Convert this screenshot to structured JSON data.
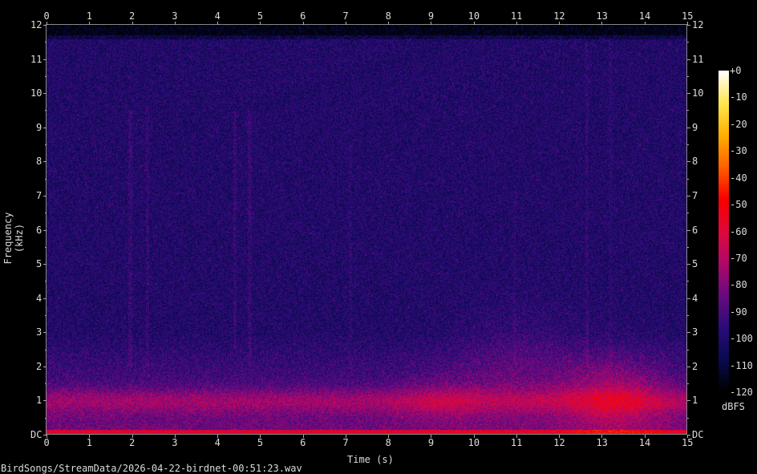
{
  "chart_data": {
    "type": "heatmap",
    "title": "",
    "xlabel": "Time (s)",
    "ylabel": "Frequency (kHz)",
    "xlim": [
      0,
      15
    ],
    "ylim": [
      0,
      12
    ],
    "x_ticks": [
      "0",
      "1",
      "2",
      "3",
      "4",
      "5",
      "6",
      "7",
      "8",
      "9",
      "10",
      "11",
      "12",
      "13",
      "14",
      "15"
    ],
    "y_ticks": [
      "DC",
      "1",
      "2",
      "3",
      "4",
      "5",
      "6",
      "7",
      "8",
      "9",
      "10",
      "11",
      "12"
    ],
    "colorbar": {
      "label": "dBFS",
      "range": [
        -120,
        0
      ],
      "ticks": [
        "+0",
        "-10",
        "-20",
        "-30",
        "-40",
        "-50",
        "-60",
        "-70",
        "-80",
        "-90",
        "-100",
        "-110",
        "-120"
      ],
      "colors": [
        "#000000",
        "#0a0a50",
        "#2a0c7a",
        "#6a0a80",
        "#b0086a",
        "#e0083a",
        "#f80000",
        "#ff6000",
        "#ffb000",
        "#ffe850",
        "#ffffff"
      ]
    },
    "filename": "BirdSongs/StreamData/2026-04-22-birdnet-00:51:23.wav"
  }
}
